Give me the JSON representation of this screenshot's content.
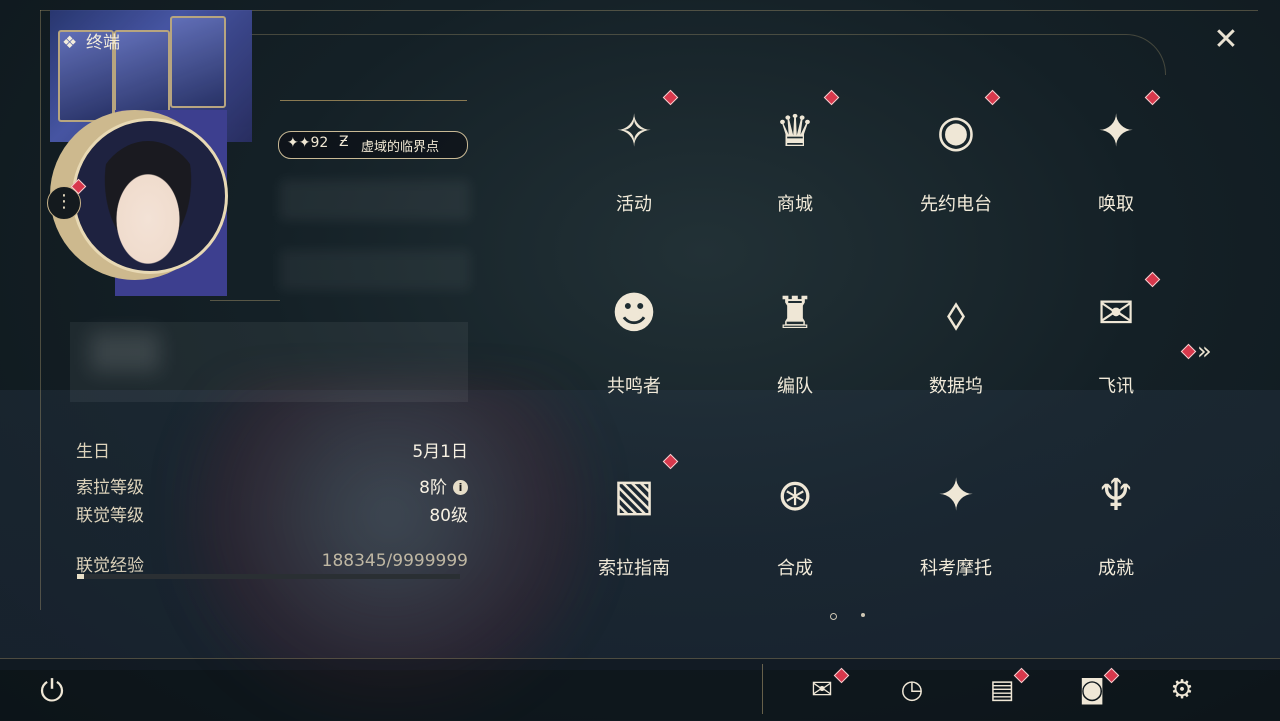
{
  "header": {
    "title": "终端"
  },
  "profile": {
    "level": "92",
    "level_symbol": "✦✦",
    "title_icon": "Ƶ",
    "title": "虚域的临界点"
  },
  "info": {
    "birthday_label": "生日",
    "birthday_value": "5月1日",
    "sola_label": "索拉等级",
    "sola_value": "8阶",
    "union_label": "联觉等级",
    "union_value": "80级",
    "exp_label": "联觉经验",
    "exp_value": "188345/9999999",
    "exp_fraction": 0.019
  },
  "menu": [
    {
      "label": "活动",
      "icon": "sparkle-icon",
      "glyph": "✧",
      "badge": true
    },
    {
      "label": "商城",
      "icon": "cart-icon",
      "glyph": "♛",
      "badge": true
    },
    {
      "label": "先约电台",
      "icon": "radio-icon",
      "glyph": "◉",
      "badge": true
    },
    {
      "label": "唤取",
      "icon": "compass-star-icon",
      "glyph": "✦",
      "badge": true
    },
    {
      "label": "共鸣者",
      "icon": "character-icon",
      "glyph": "☻",
      "badge": false
    },
    {
      "label": "编队",
      "icon": "chess-piece-icon",
      "glyph": "♜",
      "badge": false
    },
    {
      "label": "数据坞",
      "icon": "data-dock-icon",
      "glyph": "⬨",
      "badge": false
    },
    {
      "label": "飞讯",
      "icon": "message-icon",
      "glyph": "✉",
      "badge": true
    },
    {
      "label": "索拉指南",
      "icon": "guide-icon",
      "glyph": "▧",
      "badge": true
    },
    {
      "label": "合成",
      "icon": "synthesis-icon",
      "glyph": "⊛",
      "badge": false
    },
    {
      "label": "科考摩托",
      "icon": "motorbike-icon",
      "glyph": "✦",
      "badge": false
    },
    {
      "label": "成就",
      "icon": "trophy-icon",
      "glyph": "♆",
      "badge": false
    }
  ],
  "more": "»",
  "close": "✕",
  "menu_dots": "⋮",
  "power_glyph": "⏻",
  "bottom": [
    {
      "icon": "mail-icon",
      "glyph": "✉",
      "badge": true
    },
    {
      "icon": "clock-icon",
      "glyph": "◷",
      "badge": false
    },
    {
      "icon": "notes-icon",
      "glyph": "▤",
      "badge": true
    },
    {
      "icon": "camera-icon",
      "glyph": "◙",
      "badge": true
    },
    {
      "icon": "gear-icon",
      "glyph": "⚙",
      "badge": false
    }
  ]
}
